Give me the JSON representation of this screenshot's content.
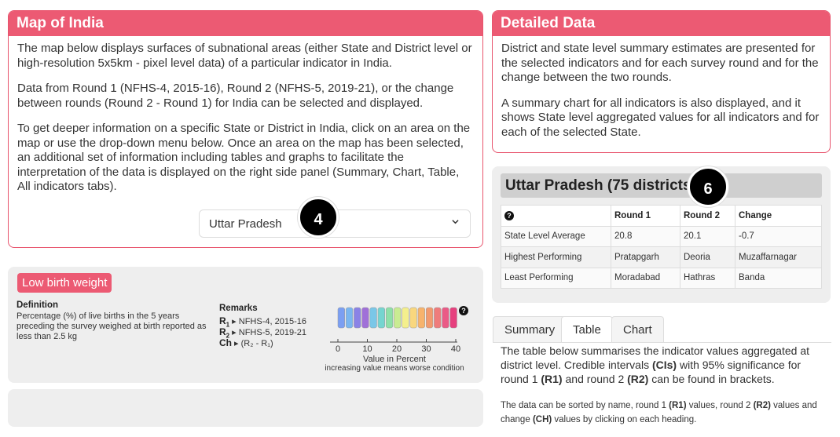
{
  "map_panel": {
    "title": "Map of India",
    "p1": "The map below displays surfaces of subnational areas (either State and District level or high-resolution 5x5km - pixel level data) of a particular indicator in India.",
    "p2": "Data from Round 1 (NFHS-4, 2015-16), Round 2 (NFHS-5, 2019-21), or the change between rounds (Round 2 - Round 1) for India can be selected and displayed.",
    "p3": "To get deeper information on a specific State or District in India, click on an area on the map or use the drop-down menu below. Once an area on the map has been selected, an additional set of information including tables and graphs to facilitate the interpretation of the data is displayed on the right side panel (Summary, Chart, Table, All indicators tabs).",
    "dropdown_value": "Uttar Pradesh",
    "callout": "4"
  },
  "detail_panel": {
    "title": "Detailed Data",
    "p1": "District and state level summary estimates are presented for the selected indicators and for each survey round and for the change between the two rounds.",
    "p2": "A summary chart for all indicators is also displayed, and it shows State level aggregated values for all indicators and for each of the selected State."
  },
  "indicator": {
    "title": "Low birth weight",
    "definition_label": "Definition",
    "definition_text": "Percentage (%) of live births in the 5 years preceding the survey weighed at birth reported as less than 2.5 kg",
    "remarks_label": "Remarks",
    "remarks": [
      {
        "key": "R",
        "sub": "1",
        "text": "NFHS-4, 2015-16"
      },
      {
        "key": "R",
        "sub": "2",
        "text": "NFHS-5, 2019-21"
      },
      {
        "key": "Ch",
        "sub": "",
        "text": "(R₂ - R₁)"
      }
    ],
    "legend_ticks": [
      "0",
      "10",
      "20",
      "30",
      "40"
    ],
    "legend_caption": "Value in Percent",
    "legend_note": "increasing value means worse condition",
    "legend_colors": [
      "#7b9ff2",
      "#7ab6f0",
      "#8a82e6",
      "#a070d8",
      "#7ac7e8",
      "#75d5d0",
      "#8ee0a8",
      "#c9ec92",
      "#f4ef8c",
      "#f9d77e",
      "#f7b36c",
      "#f29a6e",
      "#ef7b7b",
      "#ea5a86",
      "#e6407e"
    ]
  },
  "state": {
    "title": "Uttar Pradesh (75 districts)",
    "callout": "6",
    "table": {
      "headers": [
        "",
        "Round 1",
        "Round 2",
        "Change"
      ],
      "rows": [
        [
          "State Level Average",
          "20.8",
          "20.1",
          "-0.7"
        ],
        [
          "Highest Performing",
          "Pratapgarh",
          "Deoria",
          "Muzaffarnagar"
        ],
        [
          "Least Performing",
          "Moradabad",
          "Hathras",
          "Banda"
        ]
      ]
    }
  },
  "tabs": [
    "Summary",
    "Table",
    "Chart"
  ],
  "table_tab": {
    "text1_a": "The table below summarises the indicator values aggregated at district level. Credible intervals ",
    "text1_b": "(CIs)",
    "text1_c": " with 95% significance for round 1 ",
    "text1_d": "(R1)",
    "text1_e": " and round 2 ",
    "text1_f": "(R2)",
    "text1_g": " can be found in brackets.",
    "text2_a": "The data can be sorted by name, round 1 ",
    "text2_b": "(R1)",
    "text2_c": " values, round 2 ",
    "text2_d": "(R2)",
    "text2_e": " values and change ",
    "text2_f": "(CH)",
    "text2_g": " values by clicking on each heading."
  }
}
